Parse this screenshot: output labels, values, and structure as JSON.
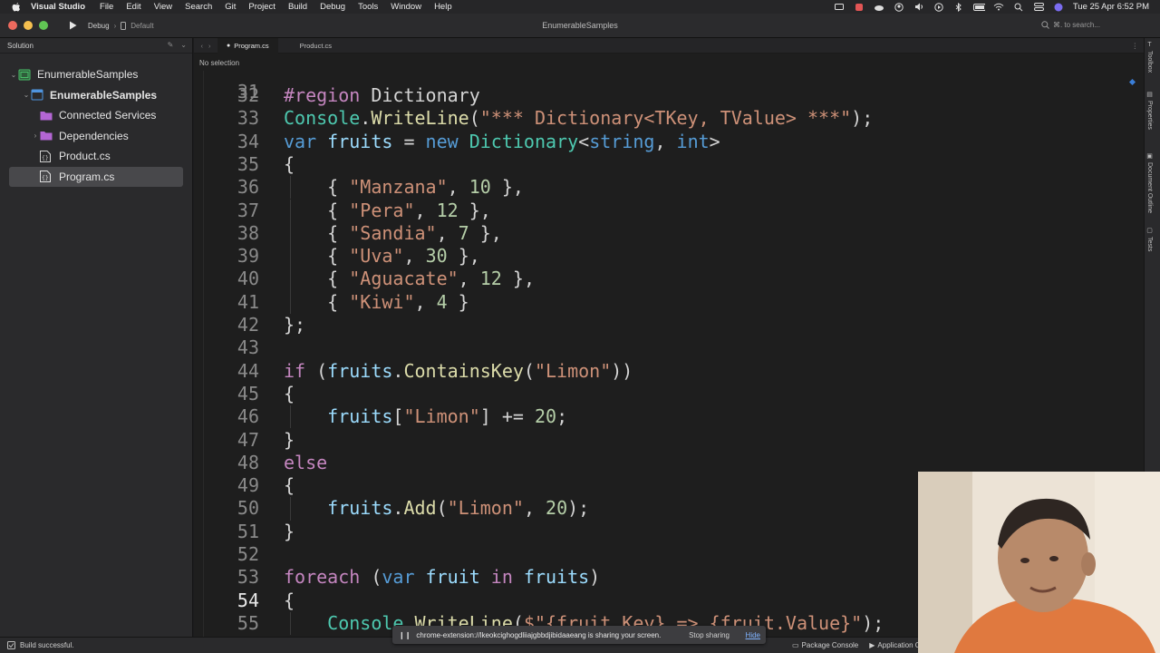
{
  "menubar": {
    "app_name": "Visual Studio",
    "items": [
      "File",
      "Edit",
      "View",
      "Search",
      "Git",
      "Project",
      "Build",
      "Debug",
      "Tools",
      "Window",
      "Help"
    ],
    "clock": "Tue 25 Apr  6:52 PM"
  },
  "toolbar": {
    "config": "Debug",
    "target": "Default",
    "window_title": "EnumerableSamples",
    "search_placeholder": "⌘. to search..."
  },
  "solution_pad": {
    "title": "Solution",
    "items": [
      {
        "label": "EnumerableSamples",
        "kind": "solution"
      },
      {
        "label": "EnumerableSamples",
        "kind": "project"
      },
      {
        "label": "Connected Services",
        "kind": "folder"
      },
      {
        "label": "Dependencies",
        "kind": "folder"
      },
      {
        "label": "Product.cs",
        "kind": "file"
      },
      {
        "label": "Program.cs",
        "kind": "file"
      }
    ]
  },
  "tabs": [
    {
      "label": "Program.cs",
      "active": true
    },
    {
      "label": "Product.cs",
      "active": false
    }
  ],
  "breadcrumb": "No selection",
  "editor": {
    "current_line": "54",
    "partial_top_line": "31",
    "lines": [
      {
        "n": "32",
        "tokens": [
          [
            "k1",
            "#region "
          ],
          [
            "pl",
            "Dictionary"
          ]
        ]
      },
      {
        "n": "33",
        "tokens": [
          [
            "ty",
            "Console"
          ],
          [
            "pl",
            "."
          ],
          [
            "fn",
            "WriteLine"
          ],
          [
            "pl",
            "("
          ],
          [
            "st",
            "\"*** Dictionary<TKey, TValue> ***\""
          ],
          [
            "pl",
            ");"
          ]
        ]
      },
      {
        "n": "34",
        "tokens": [
          [
            "k2",
            "var "
          ],
          [
            "id",
            "fruits"
          ],
          [
            "pl",
            " = "
          ],
          [
            "k2",
            "new "
          ],
          [
            "ty",
            "Dictionary"
          ],
          [
            "pl",
            "<"
          ],
          [
            "k2",
            "string"
          ],
          [
            "pl",
            ", "
          ],
          [
            "k2",
            "int"
          ],
          [
            "pl",
            ">"
          ]
        ]
      },
      {
        "n": "35",
        "tokens": [
          [
            "pl",
            "{"
          ]
        ]
      },
      {
        "n": "36",
        "tokens": [
          [
            "pl",
            "    { "
          ],
          [
            "st",
            "\"Manzana\""
          ],
          [
            "pl",
            ", "
          ],
          [
            "nm",
            "10"
          ],
          [
            "pl",
            " },"
          ]
        ]
      },
      {
        "n": "37",
        "tokens": [
          [
            "pl",
            "    { "
          ],
          [
            "st",
            "\"Pera\""
          ],
          [
            "pl",
            ", "
          ],
          [
            "nm",
            "12"
          ],
          [
            "pl",
            " },"
          ]
        ]
      },
      {
        "n": "38",
        "tokens": [
          [
            "pl",
            "    { "
          ],
          [
            "st",
            "\"Sandia\""
          ],
          [
            "pl",
            ", "
          ],
          [
            "nm",
            "7"
          ],
          [
            "pl",
            " },"
          ]
        ]
      },
      {
        "n": "39",
        "tokens": [
          [
            "pl",
            "    { "
          ],
          [
            "st",
            "\"Uva\""
          ],
          [
            "pl",
            ", "
          ],
          [
            "nm",
            "30"
          ],
          [
            "pl",
            " },"
          ]
        ]
      },
      {
        "n": "40",
        "tokens": [
          [
            "pl",
            "    { "
          ],
          [
            "st",
            "\"Aguacate\""
          ],
          [
            "pl",
            ", "
          ],
          [
            "nm",
            "12"
          ],
          [
            "pl",
            " },"
          ]
        ]
      },
      {
        "n": "41",
        "tokens": [
          [
            "pl",
            "    { "
          ],
          [
            "st",
            "\"Kiwi\""
          ],
          [
            "pl",
            ", "
          ],
          [
            "nm",
            "4"
          ],
          [
            "pl",
            " }"
          ]
        ]
      },
      {
        "n": "42",
        "tokens": [
          [
            "pl",
            "};"
          ]
        ]
      },
      {
        "n": "43",
        "tokens": []
      },
      {
        "n": "44",
        "tokens": [
          [
            "k1",
            "if "
          ],
          [
            "pl",
            "("
          ],
          [
            "id",
            "fruits"
          ],
          [
            "pl",
            "."
          ],
          [
            "fn",
            "ContainsKey"
          ],
          [
            "pl",
            "("
          ],
          [
            "st",
            "\"Limon\""
          ],
          [
            "pl",
            "))"
          ]
        ]
      },
      {
        "n": "45",
        "tokens": [
          [
            "pl",
            "{"
          ]
        ]
      },
      {
        "n": "46",
        "tokens": [
          [
            "pl",
            "    "
          ],
          [
            "id",
            "fruits"
          ],
          [
            "pl",
            "["
          ],
          [
            "st",
            "\"Limon\""
          ],
          [
            "pl",
            "] += "
          ],
          [
            "nm",
            "20"
          ],
          [
            "pl",
            ";"
          ]
        ]
      },
      {
        "n": "47",
        "tokens": [
          [
            "pl",
            "}"
          ]
        ]
      },
      {
        "n": "48",
        "tokens": [
          [
            "k1",
            "else"
          ]
        ]
      },
      {
        "n": "49",
        "tokens": [
          [
            "pl",
            "{"
          ]
        ]
      },
      {
        "n": "50",
        "tokens": [
          [
            "pl",
            "    "
          ],
          [
            "id",
            "fruits"
          ],
          [
            "pl",
            "."
          ],
          [
            "fn",
            "Add"
          ],
          [
            "pl",
            "("
          ],
          [
            "st",
            "\"Limon\""
          ],
          [
            "pl",
            ", "
          ],
          [
            "nm",
            "20"
          ],
          [
            "pl",
            ");"
          ]
        ]
      },
      {
        "n": "51",
        "tokens": [
          [
            "pl",
            "}"
          ]
        ]
      },
      {
        "n": "52",
        "tokens": []
      },
      {
        "n": "53",
        "tokens": [
          [
            "k1",
            "foreach "
          ],
          [
            "pl",
            "("
          ],
          [
            "k2",
            "var "
          ],
          [
            "id",
            "fruit "
          ],
          [
            "k1",
            "in "
          ],
          [
            "id",
            "fruits"
          ],
          [
            "pl",
            ")"
          ]
        ]
      },
      {
        "n": "54",
        "tokens": [
          [
            "pl",
            "{"
          ]
        ]
      },
      {
        "n": "55",
        "tokens": [
          [
            "pl",
            "    "
          ],
          [
            "ty",
            "Console"
          ],
          [
            "pl",
            "."
          ],
          [
            "fn",
            "WriteLine"
          ],
          [
            "pl",
            "("
          ],
          [
            "st",
            "$\"{fruit.Key} => {fruit.Value}\""
          ],
          [
            "pl",
            ");"
          ]
        ]
      }
    ]
  },
  "right_pads": [
    "Toolbox",
    "Properties",
    "Document Outline",
    "Tests"
  ],
  "status": {
    "build": "Build successful.",
    "pads": [
      "Package Console",
      "Application O"
    ]
  },
  "share_banner": {
    "message": "chrome-extension://lkeokcighogdliiajgbbdjibidaaeang is sharing your screen.",
    "stop": "Stop sharing",
    "hide": "Hide"
  },
  "colors": {
    "keyword_control": "#c586c0",
    "keyword": "#569cd6",
    "type": "#4ec9b0",
    "method": "#dcdcaa",
    "string": "#ce9178",
    "number": "#b5cea8",
    "identifier": "#9cdcfe"
  }
}
